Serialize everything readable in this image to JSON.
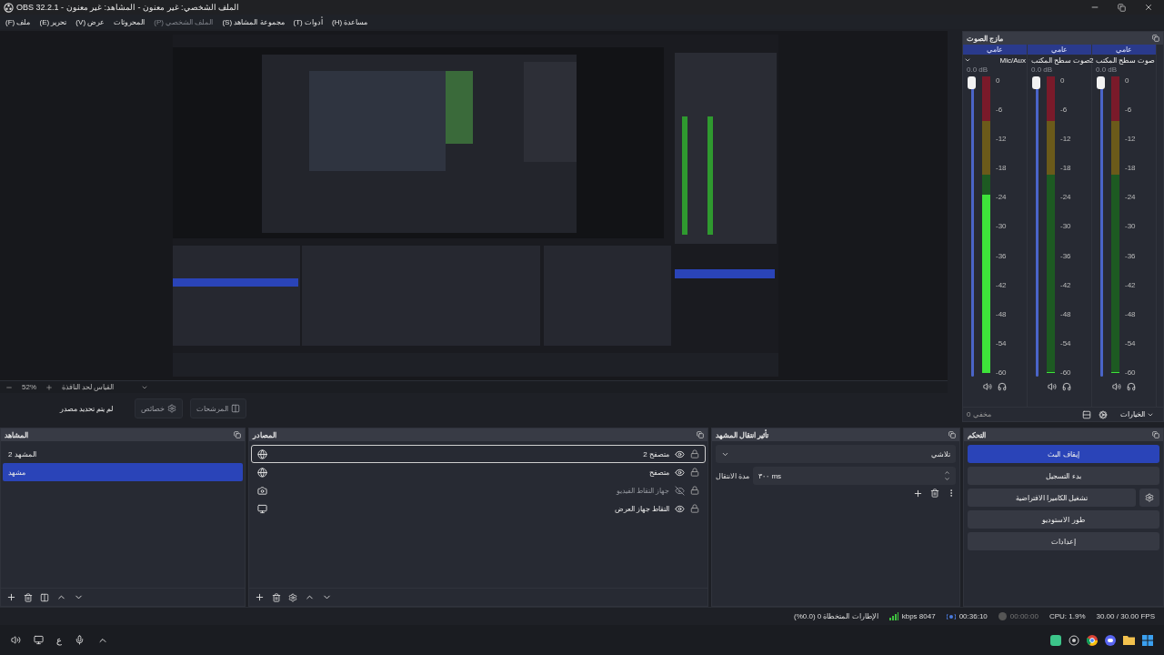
{
  "window": {
    "title": "الملف الشخصي: غير معنون - المشاهد: غير معنون - OBS 32.2.1"
  },
  "menu": [
    {
      "label": "مساعدة (H)",
      "disabled": false
    },
    {
      "label": "أدوات (T)",
      "disabled": false
    },
    {
      "label": "مجموعة المشاهد (S)",
      "disabled": false
    },
    {
      "label": "الملف الشخصي (P)",
      "disabled": true
    },
    {
      "label": "المحروثات",
      "disabled": false
    },
    {
      "label": "عرض (V)",
      "disabled": false
    },
    {
      "label": "تحرير (E)",
      "disabled": false
    },
    {
      "label": "ملف (F)",
      "disabled": false
    }
  ],
  "preview": {
    "kind": "picture",
    "zoom": "52%",
    "scale_mode": "القياس لحد النافذة"
  },
  "context_bar": {
    "status": "لم يتم تحديد مصدر",
    "properties": "خصائص",
    "filters": "المرشحات"
  },
  "mixer": {
    "title": "مازج الصوت",
    "channels": [
      {
        "tab": "عامي",
        "name": "صوت سطح المكتب 2",
        "db": "0.0 dB",
        "volume": {
          "level": 1
        },
        "meter": {
          "level": 0
        },
        "ticks": [
          "0",
          "-6",
          "-12",
          "-18",
          "-24",
          "-30",
          "-36",
          "-42",
          "-48",
          "-54",
          "-60"
        ]
      },
      {
        "tab": "عامي",
        "name": "صوت سطح المكتب",
        "db": "0.0 dB",
        "volume": {
          "level": 1
        },
        "meter": {
          "level": 0
        },
        "ticks": [
          "0",
          "-6",
          "-12",
          "-18",
          "-24",
          "-30",
          "-36",
          "-42",
          "-48",
          "-54",
          "-60"
        ]
      },
      {
        "tab": "عامي",
        "name": "Mic/Aux",
        "db": "0.0 dB",
        "volume": {
          "level": 1
        },
        "meter": {
          "level": 0.6
        },
        "ticks": [
          "0",
          "-6",
          "-12",
          "-18",
          "-24",
          "-30",
          "-36",
          "-42",
          "-48",
          "-54",
          "-60"
        ]
      }
    ],
    "hidden": "مخفي 0",
    "options": "الخيارات"
  },
  "scenes": {
    "title": "المشاهد",
    "items": [
      {
        "label": "المشهد 2",
        "selected": false
      },
      {
        "label": "مشهد",
        "selected": true
      }
    ]
  },
  "sources": {
    "title": "المصادر",
    "items": [
      {
        "name": "متصفح 2",
        "kind": "browser",
        "visible": true,
        "locked": true,
        "selected": true
      },
      {
        "name": "متصفح",
        "kind": "browser",
        "visible": true,
        "locked": true,
        "selected": false
      },
      {
        "name": "جهاز التقاط الفيديو",
        "kind": "camera",
        "visible": false,
        "locked": true,
        "selected": false
      },
      {
        "name": "التقاط جهاز العرض",
        "kind": "display",
        "visible": true,
        "locked": true,
        "selected": false
      }
    ]
  },
  "transitions": {
    "title": "تأثير انتقال المشهد",
    "effect": "تلاشي",
    "duration_label": "مدة الانتقال",
    "duration": "٣٠٠ ms"
  },
  "controls": {
    "title": "التحكم",
    "buttons": [
      {
        "label": "إيقاف البث",
        "active": true,
        "kind": "plain"
      },
      {
        "label": "بدء التسجيل",
        "active": false,
        "kind": "plain"
      },
      {
        "label": "تشغيل الكاميرا الافتراضية",
        "active": false,
        "kind": "with-settings"
      },
      {
        "label": "طور الاستوديو",
        "active": false,
        "kind": "plain"
      },
      {
        "label": "إعدادات",
        "active": false,
        "kind": "plain"
      }
    ]
  },
  "status_bar": {
    "dropped": "الإطارات المتخطاة 0 (0.0%)",
    "bitrate": "8047 kbps",
    "stream_time": "00:36:10",
    "record_time": "00:00:00",
    "cpu": "CPU: 1.9%",
    "fps": "30.00 / 30.00 FPS"
  },
  "taskbar": {
    "input_language": "ع"
  }
}
